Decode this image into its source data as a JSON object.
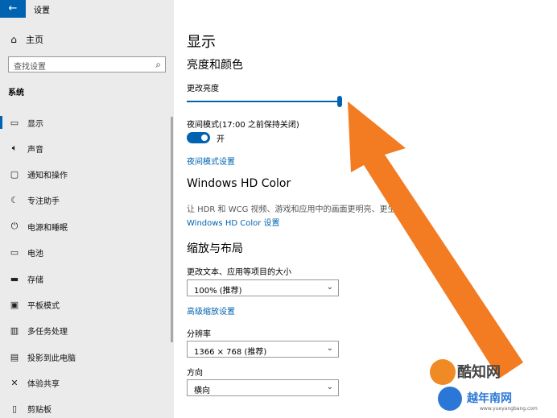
{
  "titlebar": {
    "back_icon": "back-arrow-icon",
    "title": "设置"
  },
  "sidebar": {
    "home": {
      "icon": "home-icon",
      "label": "主页"
    },
    "search_placeholder": "查找设置",
    "search_icon": "search-icon",
    "section_title": "系统",
    "items": [
      {
        "icon": "monitor-icon",
        "label": "显示",
        "active": true
      },
      {
        "icon": "speaker-icon",
        "label": "声音"
      },
      {
        "icon": "message-icon",
        "label": "通知和操作"
      },
      {
        "icon": "moon-icon",
        "label": "专注助手"
      },
      {
        "icon": "power-icon",
        "label": "电源和睡眠"
      },
      {
        "icon": "battery-icon",
        "label": "电池"
      },
      {
        "icon": "storage-icon",
        "label": "存储"
      },
      {
        "icon": "tablet-icon",
        "label": "平板模式"
      },
      {
        "icon": "multitask-icon",
        "label": "多任务处理"
      },
      {
        "icon": "project-icon",
        "label": "投影到此电脑"
      },
      {
        "icon": "share-icon",
        "label": "体验共享"
      },
      {
        "icon": "clipboard-icon",
        "label": "剪贴板"
      }
    ]
  },
  "main": {
    "title": "显示",
    "brightness_section": "亮度和颜色",
    "brightness_label": "更改亮度",
    "brightness_value": 1.0,
    "nightlight_label": "夜间模式(17:00 之前保持关闭)",
    "nightlight_state": "开",
    "nightlight_link": "夜间模式设置",
    "hd_title": "Windows HD Color",
    "hd_desc": "让 HDR 和 WCG 视频、游戏和应用中的画面更明亮、更生动。",
    "hd_link": "Windows HD Color 设置",
    "scale_title": "缩放与布局",
    "scale_label": "更改文本、应用等项目的大小",
    "scale_value": "100% (推荐)",
    "scale_link": "高级缩放设置",
    "resolution_label": "分辨率",
    "resolution_value": "1366 × 768 (推荐)",
    "orientation_label": "方向",
    "orientation_value": "横向"
  },
  "watermark": {
    "brand1": "酷知网",
    "brand2": "越年南网",
    "url": "www.yueyangbang.com"
  },
  "colors": {
    "accent": "#0063b1",
    "arrow": "#f37b22",
    "sidebar_bg": "#ebebeb"
  }
}
